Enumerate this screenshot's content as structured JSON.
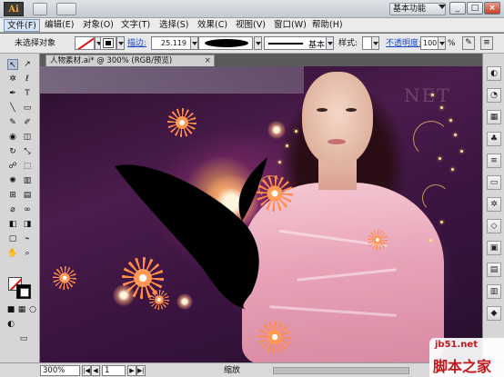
{
  "app": {
    "logo_text": "Ai",
    "workspace": "基本功能",
    "window_controls": [
      "_",
      "□",
      "×"
    ]
  },
  "menu": {
    "items": [
      "文件(F)",
      "编辑(E)",
      "对象(O)",
      "文字(T)",
      "选择(S)",
      "效果(C)",
      "视图(V)",
      "窗口(W)",
      "帮助(H)"
    ],
    "active_index": 0
  },
  "controlbar": {
    "selection_label": "未选择对象",
    "stroke_label": "描边:",
    "stroke_value": "25.119",
    "basic_label": "基本",
    "style_label": "样式:",
    "opacity_label": "不透明度:",
    "opacity_value": "100",
    "opacity_unit": "%"
  },
  "document": {
    "tab_label": "人物素材.ai* @ 300% (RGB/预览)",
    "tab_close": "×",
    "canvas_watermark": "NET"
  },
  "toolbox": {
    "tools": [
      {
        "name": "selection-tool",
        "glyph": "↖"
      },
      {
        "name": "direct-selection-tool",
        "glyph": "↗"
      },
      {
        "name": "magic-wand-tool",
        "glyph": "✲"
      },
      {
        "name": "lasso-tool",
        "glyph": "ℓ"
      },
      {
        "name": "pen-tool",
        "glyph": "✒"
      },
      {
        "name": "type-tool",
        "glyph": "T"
      },
      {
        "name": "line-tool",
        "glyph": "╲"
      },
      {
        "name": "rectangle-tool",
        "glyph": "▭"
      },
      {
        "name": "paintbrush-tool",
        "glyph": "✎"
      },
      {
        "name": "pencil-tool",
        "glyph": "✐"
      },
      {
        "name": "blob-brush-tool",
        "glyph": "◉"
      },
      {
        "name": "eraser-tool",
        "glyph": "◫"
      },
      {
        "name": "rotate-tool",
        "glyph": "↻"
      },
      {
        "name": "scale-tool",
        "glyph": "⤡"
      },
      {
        "name": "warp-tool",
        "glyph": "☍"
      },
      {
        "name": "free-transform-tool",
        "glyph": "⬚"
      },
      {
        "name": "symbol-sprayer-tool",
        "glyph": "✺"
      },
      {
        "name": "column-graph-tool",
        "glyph": "▥"
      },
      {
        "name": "mesh-tool",
        "glyph": "⊞"
      },
      {
        "name": "gradient-tool",
        "glyph": "▤"
      },
      {
        "name": "eyedropper-tool",
        "glyph": "⌀"
      },
      {
        "name": "blend-tool",
        "glyph": "∞"
      },
      {
        "name": "live-paint-tool",
        "glyph": "◧"
      },
      {
        "name": "live-paint-selection-tool",
        "glyph": "◨"
      },
      {
        "name": "artboard-tool",
        "glyph": "▢"
      },
      {
        "name": "slice-tool",
        "glyph": "⌁"
      },
      {
        "name": "hand-tool",
        "glyph": "✋"
      },
      {
        "name": "zoom-tool",
        "glyph": "⌕"
      }
    ],
    "mode_buttons": [
      "■",
      "▦",
      "○"
    ],
    "screen_mode": "▭"
  },
  "dock": {
    "buttons": [
      "◐",
      "◔",
      "▦",
      "♣",
      "≡",
      "▭",
      "✲",
      "◇",
      "▣",
      "▤",
      "▥",
      "◆"
    ]
  },
  "statusbar": {
    "zoom": "300%",
    "page": "1",
    "first": "|◀",
    "prev": "◀",
    "next": "▶",
    "last": "▶|",
    "status_text": "缩放"
  },
  "watermark": {
    "url": "jb51.net",
    "name": "脚本之家"
  },
  "colors": {
    "fill": "#ffffff",
    "stroke": "#000000",
    "link": "#1a47c9"
  }
}
